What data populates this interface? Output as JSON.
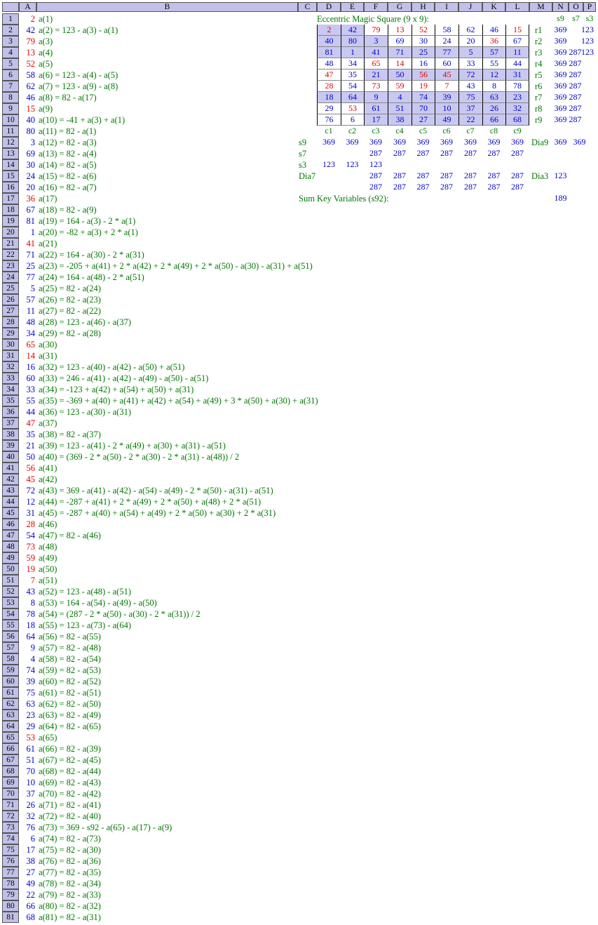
{
  "columns": [
    "A",
    "B",
    "C",
    "D",
    "E",
    "F",
    "G",
    "H",
    "I",
    "J",
    "K",
    "L",
    "M",
    "N",
    "O",
    "P"
  ],
  "rows": [
    {
      "v": "2",
      "f": "a(1)",
      "c": "r"
    },
    {
      "v": "42",
      "f": "a(2) = 123 - a(3) - a(1)",
      "c": "b"
    },
    {
      "v": "79",
      "f": "a(3)",
      "c": "r"
    },
    {
      "v": "13",
      "f": "a(4)",
      "c": "r"
    },
    {
      "v": "52",
      "f": "a(5)",
      "c": "r"
    },
    {
      "v": "58",
      "f": "a(6) = 123 - a(4) - a(5)",
      "c": "b"
    },
    {
      "v": "62",
      "f": "a(7) = 123 - a(9) - a(8)",
      "c": "b"
    },
    {
      "v": "46",
      "f": "a(8) = 82 - a(17)",
      "c": "b"
    },
    {
      "v": "15",
      "f": "a(9)",
      "c": "r"
    },
    {
      "v": "40",
      "f": "a(10) = -41 + a(3) + a(1)",
      "c": "b"
    },
    {
      "v": "80",
      "f": "a(11) = 82 - a(1)",
      "c": "b"
    },
    {
      "v": "3",
      "f": "a(12) = 82 - a(3)",
      "c": "b"
    },
    {
      "v": "69",
      "f": "a(13) = 82 - a(4)",
      "c": "b"
    },
    {
      "v": "30",
      "f": "a(14) = 82 - a(5)",
      "c": "b"
    },
    {
      "v": "24",
      "f": "a(15) = 82 - a(6)",
      "c": "b"
    },
    {
      "v": "20",
      "f": "a(16) = 82 - a(7)",
      "c": "b"
    },
    {
      "v": "36",
      "f": "a(17)",
      "c": "r"
    },
    {
      "v": "67",
      "f": "a(18) = 82 - a(9)",
      "c": "b"
    },
    {
      "v": "81",
      "f": "a(19) = 164 - a(3) - 2 * a(1)",
      "c": "b"
    },
    {
      "v": "1",
      "f": "a(20) = -82 + a(3) + 2 * a(1)",
      "c": "b"
    },
    {
      "v": "41",
      "f": "a(21)",
      "c": "r"
    },
    {
      "v": "71",
      "f": "a(22) = 164 - a(30) - 2 * a(31)",
      "c": "b"
    },
    {
      "v": "25",
      "f": "a(23) = -205 + a(41) + 2 * a(42) + 2 * a(49) + 2 * a(50) - a(30) - a(31) + a(51)",
      "c": "b"
    },
    {
      "v": "77",
      "f": "a(24) = 164 - a(48) - 2 * a(51)",
      "c": "b"
    },
    {
      "v": "5",
      "f": "a(25) = 82 - a(24)",
      "c": "b"
    },
    {
      "v": "57",
      "f": "a(26) = 82 - a(23)",
      "c": "b"
    },
    {
      "v": "11",
      "f": "a(27) = 82 - a(22)",
      "c": "b"
    },
    {
      "v": "48",
      "f": "a(28) = 123 - a(46) - a(37)",
      "c": "b"
    },
    {
      "v": "34",
      "f": "a(29) = 82 - a(28)",
      "c": "b"
    },
    {
      "v": "65",
      "f": "a(30)",
      "c": "r"
    },
    {
      "v": "14",
      "f": "a(31)",
      "c": "r"
    },
    {
      "v": "16",
      "f": "a(32) = 123 - a(40) - a(42) - a(50) + a(51)",
      "c": "b"
    },
    {
      "v": "60",
      "f": "a(33) = 246 - a(41) - a(42) - a(49) - a(50) - a(51)",
      "c": "b"
    },
    {
      "v": "33",
      "f": "a(34) = -123 + a(42) + a(54) + a(50) + a(31)",
      "c": "b"
    },
    {
      "v": "55",
      "f": "a(35) = -369 + a(40) + a(41) + a(42) + a(54) + a(49) + 3 * a(50) + a(30) + a(31)",
      "c": "b"
    },
    {
      "v": "44",
      "f": "a(36) = 123 - a(30) - a(31)",
      "c": "b"
    },
    {
      "v": "47",
      "f": "a(37)",
      "c": "r"
    },
    {
      "v": "35",
      "f": "a(38) = 82 - a(37)",
      "c": "b"
    },
    {
      "v": "21",
      "f": "a(39) = 123 - a(41) - 2 * a(49) + a(30) + a(31) - a(51)",
      "c": "b"
    },
    {
      "v": "50",
      "f": "a(40) = (369 - 2 * a(50) - 2 * a(30) - 2 * a(31) - a(48)) / 2",
      "c": "b"
    },
    {
      "v": "56",
      "f": "a(41)",
      "c": "r"
    },
    {
      "v": "45",
      "f": "a(42)",
      "c": "r"
    },
    {
      "v": "72",
      "f": "a(43) = 369 - a(41) - a(42) - a(54) - a(49) - 2 * a(50) - a(31) - a(51)",
      "c": "b"
    },
    {
      "v": "12",
      "f": "a(44) = -287 + a(41) + 2 * a(49) + 2 * a(50) + a(48) + 2 * a(51)",
      "c": "b"
    },
    {
      "v": "31",
      "f": "a(45) = -287 + a(40) + a(54) + a(49) + 2 * a(50) + a(30) + 2 * a(31)",
      "c": "b"
    },
    {
      "v": "28",
      "f": "a(46)",
      "c": "r"
    },
    {
      "v": "54",
      "f": "a(47) = 82 - a(46)",
      "c": "b"
    },
    {
      "v": "73",
      "f": "a(48)",
      "c": "r"
    },
    {
      "v": "59",
      "f": "a(49)",
      "c": "r"
    },
    {
      "v": "19",
      "f": "a(50)",
      "c": "r"
    },
    {
      "v": "7",
      "f": "a(51)",
      "c": "r"
    },
    {
      "v": "43",
      "f": "a(52) = 123 - a(48) - a(51)",
      "c": "b"
    },
    {
      "v": "8",
      "f": "a(53) = 164 - a(54) - a(49) - a(50)",
      "c": "b"
    },
    {
      "v": "78",
      "f": "a(54) = (287 - 2 * a(50) - a(30) - 2 * a(31)) / 2",
      "c": "b"
    },
    {
      "v": "18",
      "f": "a(55) = 123 - a(73) - a(64)",
      "c": "b"
    },
    {
      "v": "64",
      "f": "a(56) = 82 - a(55)",
      "c": "b"
    },
    {
      "v": "9",
      "f": "a(57) = 82 - a(48)",
      "c": "b"
    },
    {
      "v": "4",
      "f": "a(58) = 82 - a(54)",
      "c": "b"
    },
    {
      "v": "74",
      "f": "a(59) = 82 - a(53)",
      "c": "b"
    },
    {
      "v": "39",
      "f": "a(60) = 82 - a(52)",
      "c": "b"
    },
    {
      "v": "75",
      "f": "a(61) = 82 - a(51)",
      "c": "b"
    },
    {
      "v": "63",
      "f": "a(62) = 82 - a(50)",
      "c": "b"
    },
    {
      "v": "23",
      "f": "a(63) = 82 - a(49)",
      "c": "b"
    },
    {
      "v": "29",
      "f": "a(64) = 82 - a(65)",
      "c": "b"
    },
    {
      "v": "53",
      "f": "a(65)",
      "c": "r"
    },
    {
      "v": "61",
      "f": "a(66) = 82 - a(39)",
      "c": "b"
    },
    {
      "v": "51",
      "f": "a(67) = 82 - a(45)",
      "c": "b"
    },
    {
      "v": "70",
      "f": "a(68) = 82 - a(44)",
      "c": "b"
    },
    {
      "v": "10",
      "f": "a(69) = 82 - a(43)",
      "c": "b"
    },
    {
      "v": "37",
      "f": "a(70) = 82 - a(42)",
      "c": "b"
    },
    {
      "v": "26",
      "f": "a(71) = 82 - a(41)",
      "c": "b"
    },
    {
      "v": "32",
      "f": "a(72) = 82 - a(40)",
      "c": "b"
    },
    {
      "v": "76",
      "f": "a(73) = 369 - s92 - a(65) - a(17) - a(9)",
      "c": "b"
    },
    {
      "v": "6",
      "f": "a(74) = 82 - a(73)",
      "c": "b"
    },
    {
      "v": "17",
      "f": "a(75) = 82 - a(30)",
      "c": "b"
    },
    {
      "v": "38",
      "f": "a(76) = 82 - a(36)",
      "c": "b"
    },
    {
      "v": "27",
      "f": "a(77) = 82 - a(35)",
      "c": "b"
    },
    {
      "v": "49",
      "f": "a(78) = 82 - a(34)",
      "c": "b"
    },
    {
      "v": "22",
      "f": "a(79) = 82 - a(33)",
      "c": "b"
    },
    {
      "v": "66",
      "f": "a(80) = 82 - a(32)",
      "c": "b"
    },
    {
      "v": "68",
      "f": "a(81) = 82 - a(31)",
      "c": "b"
    }
  ],
  "magic": {
    "title": "Eccentric Magic Square (9 x 9):",
    "grid": [
      [
        "2",
        "42",
        "79",
        "13",
        "52",
        "58",
        "62",
        "46",
        "15"
      ],
      [
        "40",
        "80",
        "3",
        "69",
        "30",
        "24",
        "20",
        "36",
        "67"
      ],
      [
        "81",
        "1",
        "41",
        "71",
        "25",
        "77",
        "5",
        "57",
        "11"
      ],
      [
        "48",
        "34",
        "65",
        "14",
        "16",
        "60",
        "33",
        "55",
        "44"
      ],
      [
        "47",
        "35",
        "21",
        "50",
        "56",
        "45",
        "72",
        "12",
        "31"
      ],
      [
        "28",
        "54",
        "73",
        "59",
        "19",
        "7",
        "43",
        "8",
        "78"
      ],
      [
        "18",
        "64",
        "9",
        "4",
        "74",
        "39",
        "75",
        "63",
        "23"
      ],
      [
        "29",
        "53",
        "61",
        "51",
        "70",
        "10",
        "37",
        "26",
        "32"
      ],
      [
        "76",
        "6",
        "17",
        "38",
        "27",
        "49",
        "22",
        "66",
        "68"
      ]
    ],
    "red": [
      [
        1,
        0,
        1,
        1,
        1,
        0,
        0,
        0,
        1
      ],
      [
        0,
        0,
        0,
        0,
        0,
        0,
        0,
        1,
        0
      ],
      [
        0,
        0,
        0,
        0,
        0,
        0,
        0,
        0,
        0
      ],
      [
        0,
        0,
        1,
        1,
        0,
        0,
        0,
        0,
        0
      ],
      [
        1,
        0,
        0,
        0,
        1,
        1,
        0,
        0,
        0
      ],
      [
        1,
        0,
        1,
        1,
        1,
        1,
        0,
        0,
        0
      ],
      [
        0,
        0,
        0,
        0,
        0,
        0,
        0,
        0,
        0
      ],
      [
        0,
        1,
        0,
        0,
        0,
        0,
        0,
        0,
        0
      ],
      [
        0,
        0,
        0,
        0,
        0,
        0,
        0,
        0,
        0
      ]
    ],
    "shaded": [
      [
        1,
        1,
        0,
        0,
        0,
        0,
        0,
        0,
        0
      ],
      [
        1,
        1,
        1,
        0,
        0,
        0,
        0,
        0,
        0
      ],
      [
        1,
        1,
        1,
        1,
        1,
        1,
        1,
        1,
        1
      ],
      [
        0,
        0,
        0,
        0,
        0,
        0,
        0,
        0,
        0
      ],
      [
        0,
        0,
        1,
        1,
        1,
        1,
        1,
        1,
        1
      ],
      [
        0,
        0,
        0,
        0,
        0,
        0,
        0,
        0,
        0
      ],
      [
        1,
        1,
        1,
        1,
        1,
        1,
        1,
        1,
        1
      ],
      [
        0,
        0,
        1,
        1,
        1,
        1,
        1,
        1,
        1
      ],
      [
        0,
        0,
        1,
        1,
        1,
        1,
        1,
        1,
        1
      ]
    ],
    "col_headers": [
      "c1",
      "c2",
      "c3",
      "c4",
      "c5",
      "c6",
      "c7",
      "c8",
      "c9"
    ],
    "sum_headers": [
      "s9",
      "s7",
      "s3"
    ],
    "row_labels": [
      "r1",
      "r2",
      "r3",
      "r4",
      "r5",
      "r6",
      "r7",
      "r8",
      "r9"
    ],
    "row_s9": [
      "369",
      "369",
      "369",
      "369",
      "369",
      "369",
      "369",
      "369",
      "369"
    ],
    "row_s7": [
      "",
      "",
      "287",
      "287",
      "287",
      "287",
      "287",
      "287",
      "287"
    ],
    "row_s3": [
      "123",
      "123",
      "123",
      "",
      "",
      "",
      "",
      "",
      ""
    ],
    "s9_label": "s9",
    "s9_vals": [
      "369",
      "369",
      "369",
      "369",
      "369",
      "369",
      "369",
      "369",
      "369"
    ],
    "s7_label": "s7",
    "s7_vals": [
      "",
      "",
      "287",
      "287",
      "287",
      "287",
      "287",
      "287",
      "287"
    ],
    "s3_label": "s3",
    "s3_vals": [
      "123",
      "123",
      "123",
      "",
      "",
      "",
      "",
      "",
      ""
    ],
    "dia7_label": "Dia7",
    "dia7_vals": [
      "",
      "",
      "287",
      "287",
      "287",
      "287",
      "287",
      "287",
      "287"
    ],
    "extra_vals": [
      "",
      "",
      "287",
      "287",
      "287",
      "287",
      "287",
      "287",
      "287"
    ],
    "dia9_label": "Dia9",
    "dia9_vals": [
      "369",
      "369"
    ],
    "dia3_label": "Dia3",
    "dia3_val": "123",
    "skv_label": "Sum Key Variables (s92):",
    "skv_value": "189"
  }
}
